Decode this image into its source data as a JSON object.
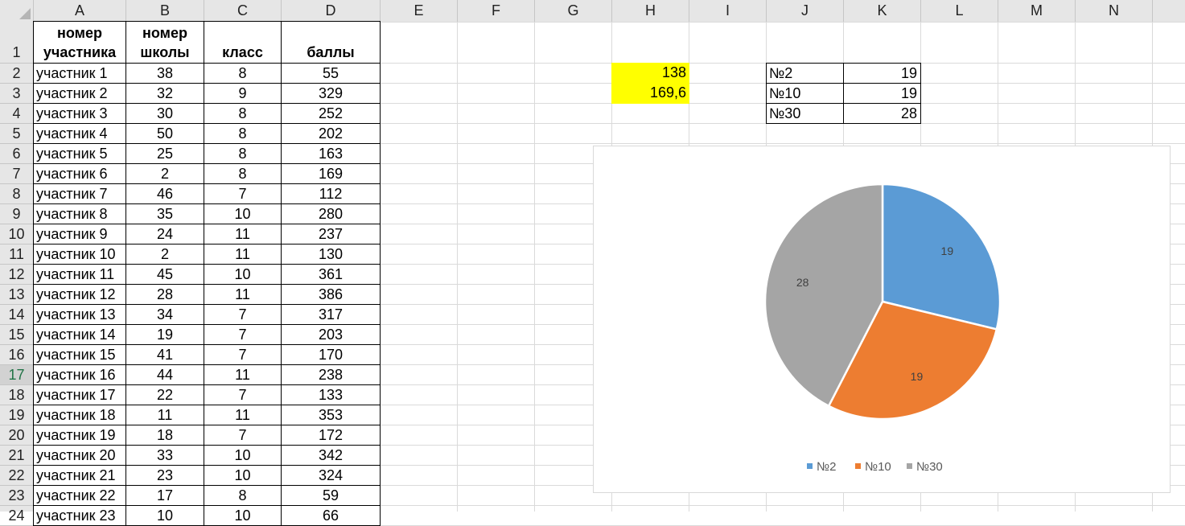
{
  "sheet": {
    "columns": [
      "A",
      "B",
      "C",
      "D",
      "E",
      "F",
      "G",
      "H",
      "I",
      "J",
      "K",
      "L",
      "M",
      "N"
    ],
    "rows": [
      "1",
      "2",
      "3",
      "4",
      "5",
      "6",
      "7",
      "8",
      "9",
      "10",
      "11",
      "12",
      "13",
      "14",
      "15",
      "16",
      "17",
      "18",
      "19",
      "20",
      "21",
      "22",
      "23",
      "24"
    ],
    "selected_row": "17",
    "headers": {
      "participant": [
        "номер",
        "участника"
      ],
      "school": [
        "номер",
        "школы"
      ],
      "grade": "класс",
      "score": "баллы"
    },
    "records": [
      [
        "участник 1",
        "38",
        "8",
        "55"
      ],
      [
        "участник 2",
        "32",
        "9",
        "329"
      ],
      [
        "участник 3",
        "30",
        "8",
        "252"
      ],
      [
        "участник 4",
        "50",
        "8",
        "202"
      ],
      [
        "участник 5",
        "25",
        "8",
        "163"
      ],
      [
        "участник 6",
        "2",
        "8",
        "169"
      ],
      [
        "участник 7",
        "46",
        "7",
        "112"
      ],
      [
        "участник 8",
        "35",
        "10",
        "280"
      ],
      [
        "участник 9",
        "24",
        "11",
        "237"
      ],
      [
        "участник 10",
        "2",
        "11",
        "130"
      ],
      [
        "участник 11",
        "45",
        "10",
        "361"
      ],
      [
        "участник 12",
        "28",
        "11",
        "386"
      ],
      [
        "участник 13",
        "34",
        "7",
        "317"
      ],
      [
        "участник 14",
        "19",
        "7",
        "203"
      ],
      [
        "участник 15",
        "41",
        "7",
        "170"
      ],
      [
        "участник 16",
        "44",
        "11",
        "238"
      ],
      [
        "участник 17",
        "22",
        "7",
        "133"
      ],
      [
        "участник 18",
        "11",
        "11",
        "353"
      ],
      [
        "участник 19",
        "18",
        "7",
        "172"
      ],
      [
        "участник 20",
        "33",
        "10",
        "342"
      ],
      [
        "участник 21",
        "23",
        "10",
        "324"
      ],
      [
        "участник 22",
        "17",
        "8",
        "59"
      ],
      [
        "участник 23",
        "10",
        "10",
        "66"
      ]
    ],
    "h_values": [
      "138",
      "169,6"
    ],
    "summary": [
      {
        "label": "№2",
        "value": "19"
      },
      {
        "label": "№10",
        "value": "19"
      },
      {
        "label": "№30",
        "value": "28"
      }
    ],
    "highlight_color": "#ffff00"
  },
  "chart_data": {
    "type": "pie",
    "categories": [
      "№2",
      "№10",
      "№30"
    ],
    "values": [
      19,
      19,
      28
    ],
    "data_labels": [
      "19",
      "19",
      "28"
    ],
    "colors": [
      "#5b9bd5",
      "#ed7d31",
      "#a5a5a5"
    ],
    "legend_position": "bottom",
    "title": ""
  }
}
